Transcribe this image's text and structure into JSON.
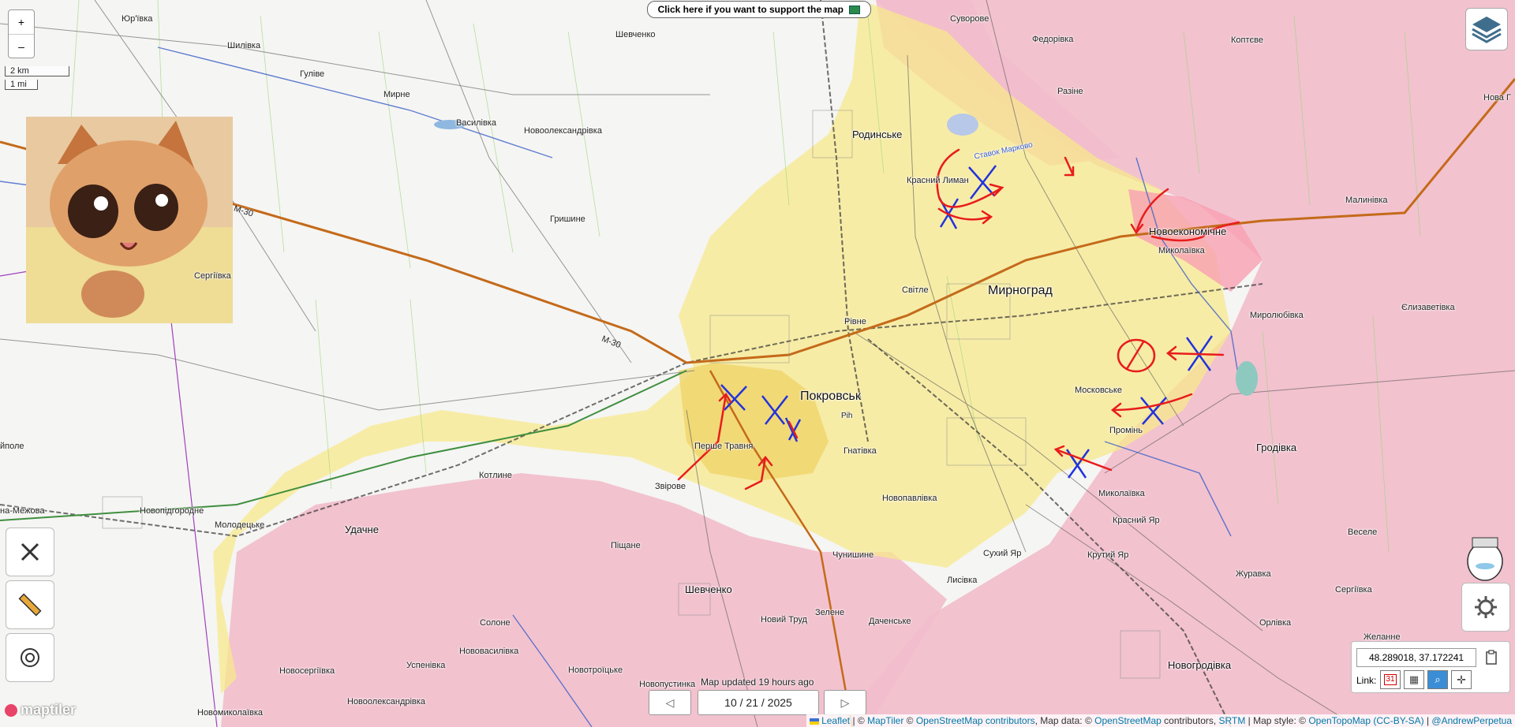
{
  "zoom": {
    "in_label": "+",
    "out_label": "–"
  },
  "scale": {
    "metric": "2 km",
    "imperial": "1 mi"
  },
  "support_banner": "Click here if you want to support the map",
  "places": [
    {
      "id": "yurivka",
      "name": "Юр'ївка",
      "cls": ""
    },
    {
      "id": "shylivka",
      "name": "Шилівка",
      "cls": ""
    },
    {
      "id": "shevchenko_n",
      "name": "Шевченко",
      "cls": ""
    },
    {
      "id": "suvorove",
      "name": "Суворове",
      "cls": ""
    },
    {
      "id": "fedorivka",
      "name": "Федорівка",
      "cls": ""
    },
    {
      "id": "koptieve",
      "name": "Коптєве",
      "cls": ""
    },
    {
      "id": "nova_hr",
      "name": "Нова Г",
      "cls": ""
    },
    {
      "id": "hulyve",
      "name": "Гуліве",
      "cls": ""
    },
    {
      "id": "myrne",
      "name": "Мирне",
      "cls": ""
    },
    {
      "id": "rozine",
      "name": "Разіне",
      "cls": ""
    },
    {
      "id": "vasylivka",
      "name": "Василівка",
      "cls": ""
    },
    {
      "id": "novooleks",
      "name": "Новоолександрівка",
      "cls": ""
    },
    {
      "id": "rodynske",
      "name": "Родинське",
      "cls": "mid"
    },
    {
      "id": "krasnyi_lyman",
      "name": "Красний Лиман",
      "cls": ""
    },
    {
      "id": "stavok",
      "name": "Ставок Марково",
      "cls": ""
    },
    {
      "id": "malynivka",
      "name": "Малинівка",
      "cls": ""
    },
    {
      "id": "hryshyne",
      "name": "Гришине",
      "cls": ""
    },
    {
      "id": "novoekon",
      "name": "Новоекономічне",
      "cls": "mid"
    },
    {
      "id": "mykolaivka_n",
      "name": "Миколаївка",
      "cls": ""
    },
    {
      "id": "serhiivka",
      "name": "Сергіївка",
      "cls": ""
    },
    {
      "id": "svitle",
      "name": "Світле",
      "cls": ""
    },
    {
      "id": "myrnohrad",
      "name": "Мирноград",
      "cls": "big"
    },
    {
      "id": "rivne",
      "name": "Рівне",
      "cls": ""
    },
    {
      "id": "myroliubivka",
      "name": "Миролюбівка",
      "cls": ""
    },
    {
      "id": "yelyzavetivka",
      "name": "Єлизаветівка",
      "cls": ""
    },
    {
      "id": "moskovske",
      "name": "Московське",
      "cls": ""
    },
    {
      "id": "pokrovsk",
      "name": "Покровськ",
      "cls": "big"
    },
    {
      "id": "rih",
      "name": "Рih",
      "cls": ""
    },
    {
      "id": "promin",
      "name": "Промінь",
      "cls": ""
    },
    {
      "id": "hnativka",
      "name": "Гнатівка",
      "cls": ""
    },
    {
      "id": "pershe_travnia",
      "name": "Перше Травня",
      "cls": ""
    },
    {
      "id": "hrodivka",
      "name": "Гродівка",
      "cls": "mid"
    },
    {
      "id": "pole",
      "name": "йполе",
      "cls": ""
    },
    {
      "id": "kotlyne",
      "name": "Котлине",
      "cls": ""
    },
    {
      "id": "zvirove",
      "name": "Звірове",
      "cls": ""
    },
    {
      "id": "mykolaivka_s",
      "name": "Миколаївка",
      "cls": ""
    },
    {
      "id": "novopavlivka",
      "name": "Новопавлівка",
      "cls": ""
    },
    {
      "id": "mezhova",
      "name": "на-Межова",
      "cls": ""
    },
    {
      "id": "novopidhorodne",
      "name": "Новопідгородне",
      "cls": ""
    },
    {
      "id": "molodetske",
      "name": "Молодецьке",
      "cls": ""
    },
    {
      "id": "udachne",
      "name": "Удачне",
      "cls": "mid"
    },
    {
      "id": "krasnyi_yar",
      "name": "Красний Яр",
      "cls": ""
    },
    {
      "id": "pishchane",
      "name": "Піщане",
      "cls": ""
    },
    {
      "id": "chunyshyne",
      "name": "Чунишине",
      "cls": ""
    },
    {
      "id": "sukhyi_yar",
      "name": "Сухий Яр",
      "cls": ""
    },
    {
      "id": "krutyi_yar",
      "name": "Крутий Яр",
      "cls": ""
    },
    {
      "id": "vesele",
      "name": "Веселе",
      "cls": ""
    },
    {
      "id": "zhuravka",
      "name": "Журавка",
      "cls": ""
    },
    {
      "id": "lysivka",
      "name": "Лисівка",
      "cls": ""
    },
    {
      "id": "shevchenko_s",
      "name": "Шевченко",
      "cls": "mid"
    },
    {
      "id": "serhiivka_se",
      "name": "Сергіївка",
      "cls": ""
    },
    {
      "id": "solone",
      "name": "Солоне",
      "cls": ""
    },
    {
      "id": "novyi_trud",
      "name": "Новий Труд",
      "cls": ""
    },
    {
      "id": "zelene",
      "name": "Зелене",
      "cls": ""
    },
    {
      "id": "dachenske",
      "name": "Даченське",
      "cls": ""
    },
    {
      "id": "orlivka",
      "name": "Орлівка",
      "cls": ""
    },
    {
      "id": "zhelanne",
      "name": "Желанне",
      "cls": ""
    },
    {
      "id": "novoserhiivka",
      "name": "Новосергіївка",
      "cls": ""
    },
    {
      "id": "uspenivka",
      "name": "Успенівка",
      "cls": ""
    },
    {
      "id": "novovasylivka",
      "name": "Нововасилівка",
      "cls": ""
    },
    {
      "id": "novotroitske",
      "name": "Новотроїцьке",
      "cls": ""
    },
    {
      "id": "novopustynka",
      "name": "Новопустинка",
      "cls": ""
    },
    {
      "id": "novohrodivka",
      "name": "Новогродівка",
      "cls": "mid"
    },
    {
      "id": "novooleks_s",
      "name": "Новоолександрівка",
      "cls": ""
    },
    {
      "id": "novomykolaivka",
      "name": "Новомиколаївка",
      "cls": ""
    }
  ],
  "road_labels": [
    {
      "id": "m30_a",
      "name": "М-30"
    },
    {
      "id": "m30_b",
      "name": "М-30"
    }
  ],
  "coordinates": {
    "value": "48.289018, 37.172241",
    "link_label": "Link:",
    "calendar_day": "31"
  },
  "date_nav": {
    "updated": "Map updated 19 hours ago",
    "date": "10 / 21 / 2025"
  },
  "attribution": {
    "leaflet": "Leaflet",
    "sep1": " | © ",
    "maptiler": "MapTiler",
    "sep2": " © ",
    "osm": "OpenStreetMap contributors",
    "data_label": ", Map data: © ",
    "osm2": "OpenStreetMap",
    "contrib": " contributors, ",
    "srtm": "SRTM",
    "style_label": " | Map style: © ",
    "otm": "OpenTopoMap",
    "ccbysa": "(CC-BY-SA)",
    "sep3": " | ",
    "author": "@AndrewPerpetua"
  },
  "logo": "maptiler",
  "colors": {
    "russian_control": "#f2b8c6",
    "contested": "#f6e27a",
    "ukraine_arrow": "#2233dd",
    "russia_arrow": "#e81c1c"
  }
}
